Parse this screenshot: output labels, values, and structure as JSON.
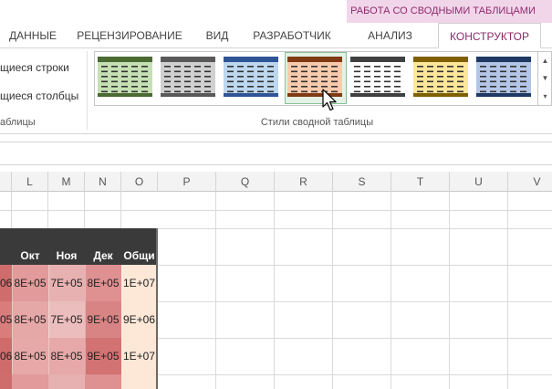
{
  "contextual": {
    "title": "РАБОТА СО СВОДНЫМИ ТАБЛИЦАМИ",
    "color": "#8e2a6c"
  },
  "tabs": [
    {
      "label": "ДАННЫЕ"
    },
    {
      "label": "РЕЦЕНЗИРОВАНИЕ"
    },
    {
      "label": "ВИД"
    },
    {
      "label": "РАЗРАБОТЧИК"
    },
    {
      "label": "АНАЛИЗ"
    },
    {
      "label": "КОНСТРУКТОР",
      "active": true
    }
  ],
  "ribbon": {
    "options": {
      "row_label": "щиеся строки",
      "col_label": "щиеся столбцы",
      "group_label": "аблицы"
    },
    "styles": {
      "group_label": "Стили сводной таблицы",
      "thumbnails": [
        {
          "name": "green",
          "header": "#4a6b32",
          "fill": "#c5e0b3"
        },
        {
          "name": "gray",
          "header": "#595959",
          "fill": "#d0d0d0"
        },
        {
          "name": "blue",
          "header": "#2f5597",
          "fill": "#bdd7ee"
        },
        {
          "name": "orange",
          "header": "#7f3b13",
          "fill": "#f8cbad",
          "hovered": true
        },
        {
          "name": "white",
          "header": "#404040",
          "fill": "#ffffff"
        },
        {
          "name": "yellow",
          "header": "#7f6000",
          "fill": "#ffe699"
        },
        {
          "name": "indigo",
          "header": "#1f3864",
          "fill": "#b4c6e7"
        }
      ]
    }
  },
  "columns": [
    "L",
    "M",
    "N",
    "O",
    "P",
    "Q",
    "R",
    "S",
    "T",
    "U",
    "V"
  ],
  "pivot": {
    "headers": [
      "Окт",
      "Ноя",
      "Дек",
      "Общи"
    ],
    "rows": [
      {
        "prefix": "06",
        "values": [
          "8E+05",
          "7E+05",
          "8E+05",
          "1E+07"
        ]
      },
      {
        "prefix": "05",
        "values": [
          "8E+05",
          "7E+05",
          "9E+05",
          "9E+06"
        ]
      },
      {
        "prefix": "06",
        "values": [
          "8E+05",
          "8E+05",
          "9E+05",
          "1E+07"
        ]
      }
    ],
    "colors": {
      "header": "#3a3a3a",
      "cells": [
        [
          "#cf6d6d",
          "#e29a9a",
          "#e8b1b1",
          "#df9090",
          "#fde7d6"
        ],
        [
          "#d87c7c",
          "#e6a7a7",
          "#ecbdbd",
          "#d98484",
          "#fde7d6"
        ],
        [
          "#cf6b6b",
          "#e7a8a8",
          "#e6a8a8",
          "#d27272",
          "#fde7d6"
        ]
      ]
    }
  }
}
